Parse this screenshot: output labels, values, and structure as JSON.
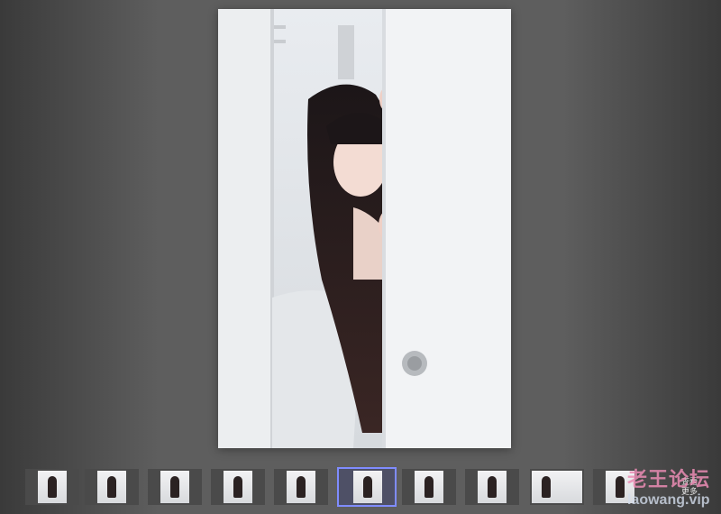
{
  "viewer": {
    "main_image": {
      "subject": "photo-girl-peeking-from-door"
    },
    "thumbnails": [
      {
        "label": "thumb-1"
      },
      {
        "label": "thumb-2"
      },
      {
        "label": "thumb-3"
      },
      {
        "label": "thumb-4"
      },
      {
        "label": "thumb-5"
      },
      {
        "label": "thumb-6",
        "active": true
      },
      {
        "label": "thumb-7"
      },
      {
        "label": "thumb-8"
      },
      {
        "label": "thumb-9"
      },
      {
        "label": "thumb-10"
      }
    ],
    "more_button": {
      "line1": "查看",
      "line2": "更多"
    }
  },
  "watermark": {
    "cn": "老王论坛",
    "en": "laowang.vip"
  },
  "colors": {
    "active_border": "#7f8cff",
    "watermark_pink": "#eb8cb4"
  }
}
